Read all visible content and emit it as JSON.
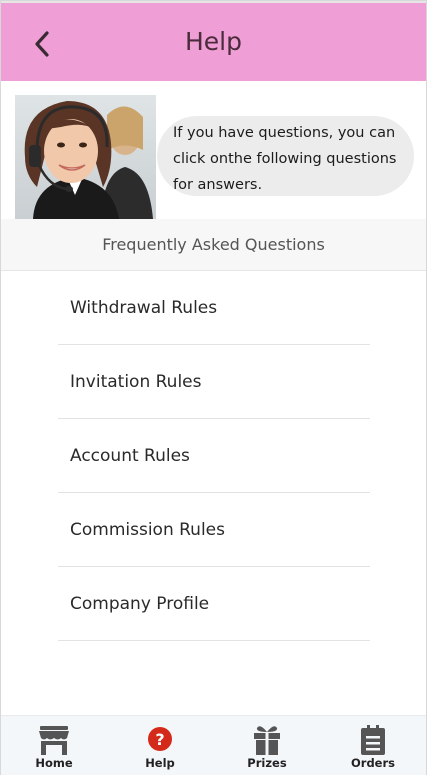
{
  "header": {
    "title": "Help",
    "back_icon": "chevron-left-icon"
  },
  "intro": {
    "photo": "customer-service-agent-photo",
    "message": "If you have questions, you can click onthe following questions for answers."
  },
  "faq": {
    "heading": "Frequently Asked Questions",
    "items": [
      {
        "label": "Withdrawal Rules"
      },
      {
        "label": "Invitation Rules"
      },
      {
        "label": "Account Rules"
      },
      {
        "label": "Commission Rules"
      },
      {
        "label": "Company Profile"
      }
    ]
  },
  "tabbar": {
    "items": [
      {
        "label": "Home",
        "icon": "store-icon"
      },
      {
        "label": "Help",
        "icon": "question-circle-icon",
        "active_color": "#d42a1a"
      },
      {
        "label": "Prizes",
        "icon": "gift-icon"
      },
      {
        "label": "Orders",
        "icon": "clipboard-icon"
      }
    ]
  },
  "colors": {
    "header_bg": "#f09fd6",
    "accent": "#d42a1a"
  }
}
